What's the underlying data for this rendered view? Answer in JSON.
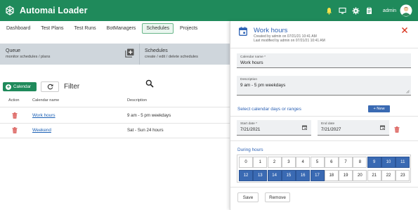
{
  "app": {
    "brand": "Automai Loader",
    "user": "admin"
  },
  "colors": {
    "brand": "#1f8a5b",
    "accent": "#2d62b5",
    "selected_hour": "#3a6ab3",
    "delete": "#d9534f"
  },
  "nav": {
    "items": [
      "Dashboard",
      "Test Plans",
      "Test Runs",
      "BotManagers",
      "Schedules",
      "Projects"
    ],
    "active": "Schedules"
  },
  "band": {
    "queue_title": "Queue",
    "queue_sub": "monitor schedules / plans",
    "schedules_title": "Schedules",
    "schedules_sub": "create / edit / delete schedules"
  },
  "toolbar": {
    "calendar_button": "Calendar",
    "filter_label": "Filter"
  },
  "table": {
    "headers": {
      "action": "Action",
      "name": "Calendar name",
      "description": "Description"
    },
    "rows": [
      {
        "name": "Work hours",
        "description": "9 am - 5 pm weekdays"
      },
      {
        "name": "Weekend",
        "description": "Sat - Sun 24 hours"
      }
    ]
  },
  "panel": {
    "title": "Work hours",
    "created": "Created by admin on 07/21/21 10:41 AM",
    "modified": "Last modified by admin on 07/21/21 10:41 AM",
    "name_label": "Calendar name *",
    "name_value": "Work hours",
    "desc_label": "Description",
    "desc_value": "9 am - 5 pm weekdays",
    "select_days": "Select calendar days or ranges",
    "new_button": "+ New",
    "start_label": "Start date *",
    "start_value": "7/21/2021",
    "end_label": "End date",
    "end_value": "7/21/2027",
    "hours_title": "During hours",
    "hours": [
      "0",
      "1",
      "2",
      "3",
      "4",
      "5",
      "6",
      "7",
      "8",
      "9",
      "10",
      "11",
      "12",
      "13",
      "14",
      "15",
      "16",
      "17",
      "18",
      "19",
      "20",
      "21",
      "22",
      "23"
    ],
    "selected_hours": [
      9,
      10,
      11,
      12,
      13,
      14,
      15,
      16,
      17
    ],
    "save_button": "Save",
    "remove_button": "Remove"
  },
  "icons": [
    "logo-icon",
    "bell-icon",
    "monitor-icon",
    "gear-icon",
    "clipboard-icon",
    "avatar-icon",
    "add-box-icon",
    "plus-circle-icon",
    "refresh-icon",
    "search-icon",
    "trash-icon",
    "calendar-icon",
    "close-icon",
    "date-picker-icon",
    "resize-handle-icon"
  ]
}
